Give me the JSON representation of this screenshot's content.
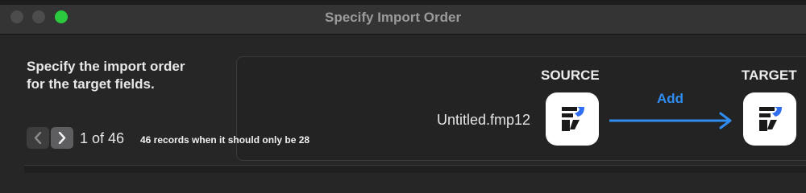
{
  "window": {
    "title": "Specify Import Order",
    "controls": [
      "close",
      "minimize",
      "zoom"
    ],
    "zoom_color": "#2bc840"
  },
  "instructions": {
    "line1": "Specify the import order",
    "line2": "for the target fields."
  },
  "mapping": {
    "source_header": "SOURCE",
    "target_header": "TARGET",
    "source_file": "Untitled.fmp12",
    "action_label": "Add",
    "action_color": "#2f8cf0",
    "source_icon": "filemaker-app-icon",
    "target_icon": "filemaker-app-icon"
  },
  "navigation": {
    "prev_icon": "chevron-left-icon",
    "next_icon": "chevron-right-icon",
    "counter": "1 of 46",
    "note": "46 records when it should only be 28"
  }
}
